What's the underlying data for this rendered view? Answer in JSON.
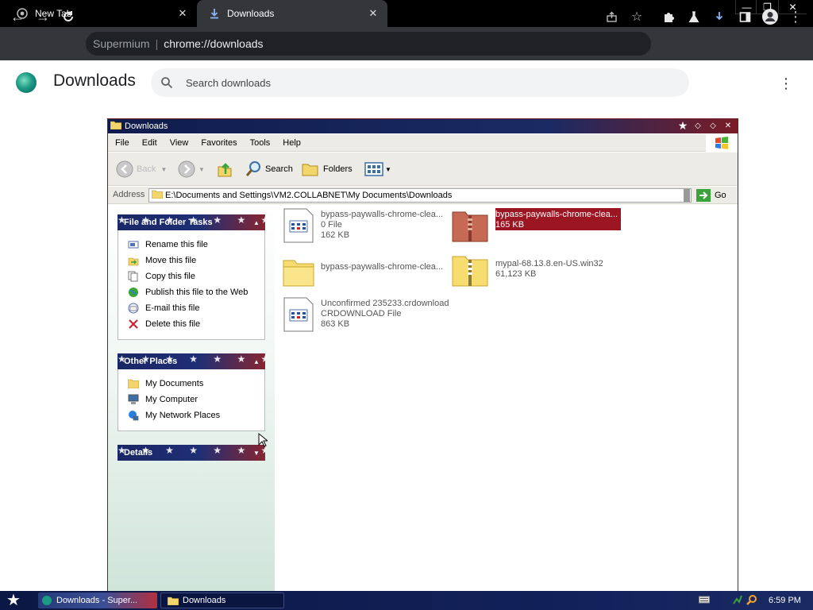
{
  "browser": {
    "tabs": [
      {
        "title": "New Tab",
        "icon": "chrome-icon"
      },
      {
        "title": "Downloads",
        "icon": "download-icon",
        "active": true
      }
    ],
    "omnibox": {
      "prefix": "Supermium",
      "url": "chrome://downloads"
    }
  },
  "downloads_page": {
    "title": "Downloads",
    "search_placeholder": "Search downloads"
  },
  "explorer": {
    "title": "Downloads",
    "menu": [
      "File",
      "Edit",
      "View",
      "Favorites",
      "Tools",
      "Help"
    ],
    "toolbar": {
      "back_label": "Back",
      "search_label": "Search",
      "folders_label": "Folders"
    },
    "address": {
      "label": "Address",
      "path": "E:\\Documents and Settings\\VM2.COLLABNET\\My Documents\\Downloads",
      "go_label": "Go"
    },
    "file_tasks": {
      "title": "File and Folder Tasks",
      "items": [
        "Rename this file",
        "Move this file",
        "Copy this file",
        "Publish this file to the Web",
        "E-mail this file",
        "Delete this file"
      ]
    },
    "other_places": {
      "title": "Other Places",
      "items": [
        "My Documents",
        "My Computer",
        "My Network Places"
      ]
    },
    "details": {
      "title": "Details"
    },
    "files": [
      {
        "name": "bypass-paywalls-chrome-clea...",
        "type": "0 File",
        "size": "162 KB",
        "icon": "generic-file-icon"
      },
      {
        "name": "bypass-paywalls-chrome-clea...",
        "type": "",
        "size": "165 KB",
        "icon": "zip-folder-icon",
        "selected": true
      },
      {
        "name": "bypass-paywalls-chrome-clea...",
        "type": "",
        "size": "",
        "icon": "folder-icon"
      },
      {
        "name": "mypal-68.13.8.en-US.win32",
        "type": "",
        "size": "61,123 KB",
        "icon": "zip-folder-icon"
      },
      {
        "name": "Unconfirmed 235233.crdownload",
        "type": "CRDOWNLOAD File",
        "size": "863 KB",
        "icon": "generic-file-icon"
      }
    ]
  },
  "taskbar": {
    "tasks": [
      "Downloads - Super...",
      "Downloads"
    ],
    "clock": "6:59 PM"
  }
}
